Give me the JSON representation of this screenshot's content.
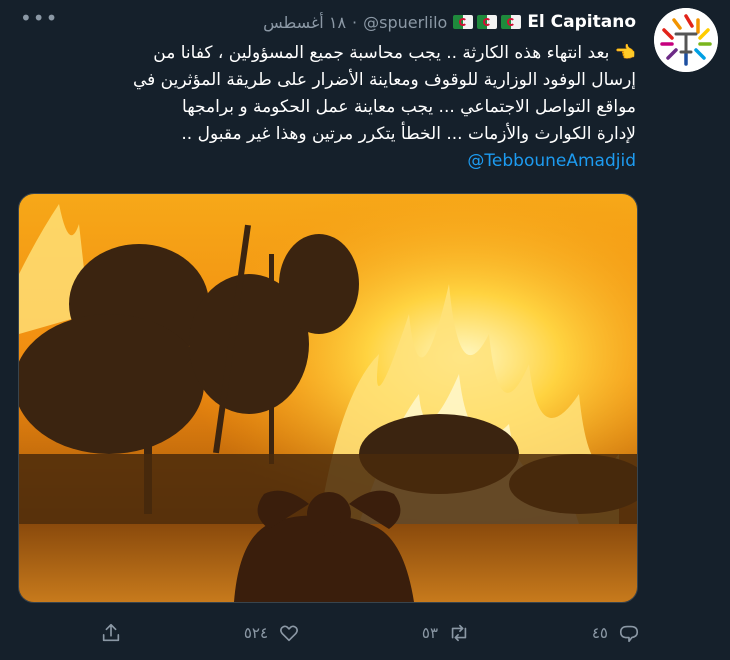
{
  "tweet": {
    "author_name": "El Capitano",
    "flags": [
      "algeria-flag",
      "algeria-flag",
      "algeria-flag"
    ],
    "handle": "@spuerlilo",
    "separator": "·",
    "date": "١٨ أغسطس",
    "lines": [
      "👈 بعد انتهاء هذه الكارثة .. يجب محاسبة جميع المسؤولين ، كفانا من",
      "إرسال الوفود الوزارية للوقوف ومعاينة الأضرار على طريقة المؤثرين في",
      "مواقع التواصل الاجتماعي ... يجب معاينة عمل الحكومة و برامجها",
      "لإدارة الكوارث والأزمات ... الخطأ يتكرر مرتين وهذا غير مقبول .."
    ],
    "mention": "@TebbouneAmadjid",
    "image_description_icon": "wildfire-photo",
    "actions": {
      "reply_count": "٤٥",
      "retweet_count": "٥٣",
      "like_count": "٥٢٤"
    }
  },
  "colors": {
    "background": "#15202b",
    "text": "#ffffff",
    "muted": "#8b98a5",
    "link": "#1d9bf0"
  }
}
